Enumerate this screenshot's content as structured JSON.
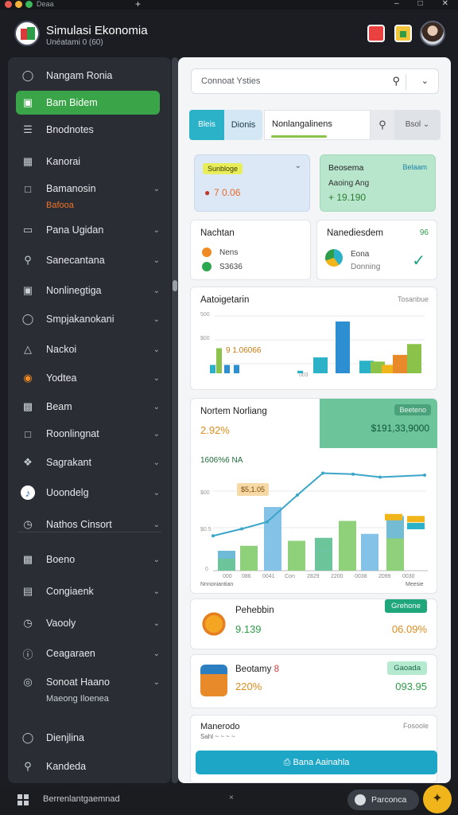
{
  "window": {
    "tab_title": "Deaa",
    "new_tab": "+",
    "controls": [
      "–",
      "□",
      "✕"
    ]
  },
  "app": {
    "name": "Simulasi Ekonomia",
    "subtitle": "Unéatami 0 (60)"
  },
  "sidebar": {
    "items": [
      {
        "label": "Nangam Ronia",
        "icon": "coins-icon",
        "chev": false
      },
      {
        "label": "Bam Bidem",
        "icon": "chat-icon",
        "chev": false,
        "active": true
      },
      {
        "label": "Bnodnotes",
        "icon": "book-icon",
        "chev": false
      },
      {
        "label": "Kanorai",
        "icon": "calculator-icon",
        "chev": false
      },
      {
        "label": "Bamanosin",
        "icon": "folder-icon",
        "chev": true,
        "sub": "Bafooa"
      },
      {
        "label": "Pana Ugidan",
        "icon": "document-icon",
        "chev": true
      },
      {
        "label": "Sanecantana",
        "icon": "search-icon",
        "chev": true
      },
      {
        "label": "Nonlinegtiga",
        "icon": "image-icon",
        "chev": true
      },
      {
        "label": "Smpjakanokani",
        "icon": "shield-icon",
        "chev": true
      },
      {
        "label": "Nackoi",
        "icon": "warning-icon",
        "chev": true
      },
      {
        "label": "Yodtea",
        "icon": "pizza-icon",
        "chev": true
      },
      {
        "label": "Beam",
        "icon": "cards-icon",
        "chev": true
      },
      {
        "label": "Roonlingnat",
        "icon": "square-icon",
        "chev": true
      },
      {
        "label": "Sagrakant",
        "icon": "puzzle-icon",
        "chev": true
      },
      {
        "label": "Uoondelg",
        "icon": "music-icon",
        "chev": true
      },
      {
        "label": "Nathos Cinsort",
        "icon": "clock-icon",
        "chev": true
      },
      {
        "label": "Boeno",
        "icon": "building-icon",
        "chev": true
      },
      {
        "label": "Congiaenk",
        "icon": "window-icon",
        "chev": true
      },
      {
        "label": "Vaooly",
        "icon": "timer-icon",
        "chev": true
      },
      {
        "label": "Ceagaraen",
        "icon": "info-icon",
        "chev": true
      },
      {
        "label": "Sonoat Haano",
        "icon": "target-icon",
        "chev": true,
        "sub": "Maeong Iloenea"
      },
      {
        "label": "Dienjlina",
        "icon": "globe-icon",
        "chev": false
      },
      {
        "label": "Kandeda",
        "icon": "search-icon",
        "chev": false
      }
    ]
  },
  "search": {
    "placeholder": "Connoat   Ysties"
  },
  "tabs": {
    "t1": "Bleis",
    "t2": "Dionis",
    "t3": "Nonlangalinens",
    "t5": "Bsol"
  },
  "card_a": {
    "chip": "Sunbloge",
    "value": "7 0.06"
  },
  "card_b": {
    "title": "Beosema",
    "chip": "Belaam",
    "label": "Aaoing Ang",
    "value": "19.190",
    "prefix": "+"
  },
  "card_c": {
    "title": "Nachtan",
    "r1": "Nens",
    "r2": "S3636"
  },
  "card_d": {
    "title": "Nanediesdem",
    "badge": "96",
    "r1": "Eona",
    "r2": "Donning"
  },
  "chart1": {
    "title": "Aatoigetarin",
    "corner": "Tosanbue",
    "y_top": "500",
    "y_mid": "$00",
    "annotation": "9 1.06066",
    "xlabel": "003"
  },
  "chart2": {
    "title": "Nortem Norliang",
    "pct": "2.92%",
    "banner_chip": "Beeteno",
    "banner_value": "$191,33,9000",
    "sub": "1606%6 NA",
    "callout": "$5,1.05",
    "y_labels": [
      "$00",
      "$0.5",
      "0"
    ],
    "x_labels": [
      "000",
      "086",
      "0041",
      "Con",
      "2829",
      "2200",
      "0038",
      "2099",
      "0030"
    ],
    "x_left": "Nnnoniantian",
    "x_right": "Meesie"
  },
  "chart_data": [
    {
      "type": "bar",
      "title": "Aatoigetarin",
      "series": [
        {
          "values": [
            1,
            3,
            1,
            1,
            0.3,
            1.9,
            6.2,
            1.5,
            1.4,
            1,
            2.2,
            3.5
          ]
        }
      ]
    },
    {
      "type": "bar",
      "title": "Nortem Norliang",
      "series": [
        {
          "name": "blue",
          "values": [
            2,
            0,
            6.4,
            1,
            2,
            0,
            3.7,
            5.5
          ]
        },
        {
          "name": "green",
          "values": [
            2,
            2.5,
            0,
            3,
            3.3,
            5,
            0,
            5.4
          ]
        }
      ],
      "line": [
        3.5,
        3.8,
        4.9,
        7.6,
        9.8,
        9.7,
        9.4
      ]
    }
  ],
  "card_e": {
    "title": "Pehebbin",
    "chip": "Grehone",
    "value": "9.139",
    "right": "06.09%"
  },
  "card_f": {
    "title": "Beotamy",
    "badge": "8",
    "chip": "Gaoada",
    "value": "220%",
    "right": "093.95"
  },
  "card_g": {
    "title": "Manerodo",
    "corner": "Fosoole",
    "tiny": "Sahl ~ ~ ~ ~",
    "button": "Bana Aainahla"
  },
  "taskbar": {
    "label": "Berrenlantgaemnad",
    "mid": "×",
    "pill": "Parconca",
    "fab": "✦"
  },
  "colors": {
    "accent_green": "#3aa548",
    "accent_teal": "#2bb1c8"
  }
}
